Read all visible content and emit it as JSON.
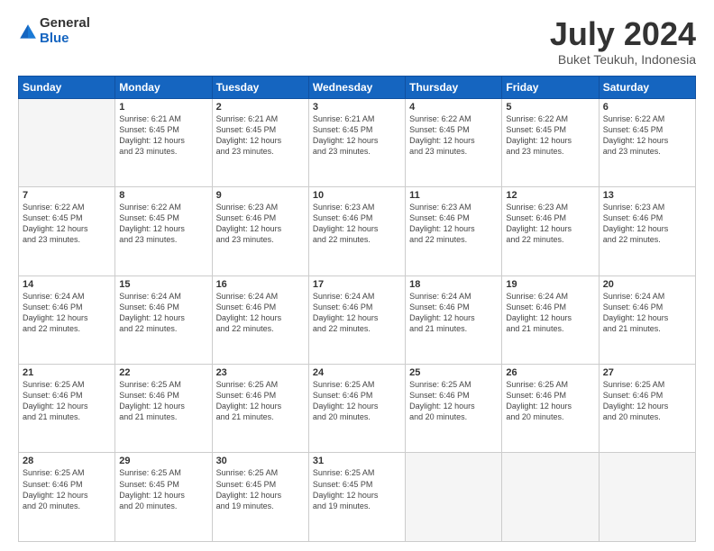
{
  "logo": {
    "general": "General",
    "blue": "Blue"
  },
  "header": {
    "month": "July 2024",
    "location": "Buket Teukuh, Indonesia"
  },
  "weekdays": [
    "Sunday",
    "Monday",
    "Tuesday",
    "Wednesday",
    "Thursday",
    "Friday",
    "Saturday"
  ],
  "weeks": [
    [
      {
        "day": "",
        "info": ""
      },
      {
        "day": "1",
        "info": "Sunrise: 6:21 AM\nSunset: 6:45 PM\nDaylight: 12 hours\nand 23 minutes."
      },
      {
        "day": "2",
        "info": "Sunrise: 6:21 AM\nSunset: 6:45 PM\nDaylight: 12 hours\nand 23 minutes."
      },
      {
        "day": "3",
        "info": "Sunrise: 6:21 AM\nSunset: 6:45 PM\nDaylight: 12 hours\nand 23 minutes."
      },
      {
        "day": "4",
        "info": "Sunrise: 6:22 AM\nSunset: 6:45 PM\nDaylight: 12 hours\nand 23 minutes."
      },
      {
        "day": "5",
        "info": "Sunrise: 6:22 AM\nSunset: 6:45 PM\nDaylight: 12 hours\nand 23 minutes."
      },
      {
        "day": "6",
        "info": "Sunrise: 6:22 AM\nSunset: 6:45 PM\nDaylight: 12 hours\nand 23 minutes."
      }
    ],
    [
      {
        "day": "7",
        "info": "Sunrise: 6:22 AM\nSunset: 6:45 PM\nDaylight: 12 hours\nand 23 minutes."
      },
      {
        "day": "8",
        "info": "Sunrise: 6:22 AM\nSunset: 6:45 PM\nDaylight: 12 hours\nand 23 minutes."
      },
      {
        "day": "9",
        "info": "Sunrise: 6:23 AM\nSunset: 6:46 PM\nDaylight: 12 hours\nand 23 minutes."
      },
      {
        "day": "10",
        "info": "Sunrise: 6:23 AM\nSunset: 6:46 PM\nDaylight: 12 hours\nand 22 minutes."
      },
      {
        "day": "11",
        "info": "Sunrise: 6:23 AM\nSunset: 6:46 PM\nDaylight: 12 hours\nand 22 minutes."
      },
      {
        "day": "12",
        "info": "Sunrise: 6:23 AM\nSunset: 6:46 PM\nDaylight: 12 hours\nand 22 minutes."
      },
      {
        "day": "13",
        "info": "Sunrise: 6:23 AM\nSunset: 6:46 PM\nDaylight: 12 hours\nand 22 minutes."
      }
    ],
    [
      {
        "day": "14",
        "info": "Sunrise: 6:24 AM\nSunset: 6:46 PM\nDaylight: 12 hours\nand 22 minutes."
      },
      {
        "day": "15",
        "info": "Sunrise: 6:24 AM\nSunset: 6:46 PM\nDaylight: 12 hours\nand 22 minutes."
      },
      {
        "day": "16",
        "info": "Sunrise: 6:24 AM\nSunset: 6:46 PM\nDaylight: 12 hours\nand 22 minutes."
      },
      {
        "day": "17",
        "info": "Sunrise: 6:24 AM\nSunset: 6:46 PM\nDaylight: 12 hours\nand 22 minutes."
      },
      {
        "day": "18",
        "info": "Sunrise: 6:24 AM\nSunset: 6:46 PM\nDaylight: 12 hours\nand 21 minutes."
      },
      {
        "day": "19",
        "info": "Sunrise: 6:24 AM\nSunset: 6:46 PM\nDaylight: 12 hours\nand 21 minutes."
      },
      {
        "day": "20",
        "info": "Sunrise: 6:24 AM\nSunset: 6:46 PM\nDaylight: 12 hours\nand 21 minutes."
      }
    ],
    [
      {
        "day": "21",
        "info": "Sunrise: 6:25 AM\nSunset: 6:46 PM\nDaylight: 12 hours\nand 21 minutes."
      },
      {
        "day": "22",
        "info": "Sunrise: 6:25 AM\nSunset: 6:46 PM\nDaylight: 12 hours\nand 21 minutes."
      },
      {
        "day": "23",
        "info": "Sunrise: 6:25 AM\nSunset: 6:46 PM\nDaylight: 12 hours\nand 21 minutes."
      },
      {
        "day": "24",
        "info": "Sunrise: 6:25 AM\nSunset: 6:46 PM\nDaylight: 12 hours\nand 20 minutes."
      },
      {
        "day": "25",
        "info": "Sunrise: 6:25 AM\nSunset: 6:46 PM\nDaylight: 12 hours\nand 20 minutes."
      },
      {
        "day": "26",
        "info": "Sunrise: 6:25 AM\nSunset: 6:46 PM\nDaylight: 12 hours\nand 20 minutes."
      },
      {
        "day": "27",
        "info": "Sunrise: 6:25 AM\nSunset: 6:46 PM\nDaylight: 12 hours\nand 20 minutes."
      }
    ],
    [
      {
        "day": "28",
        "info": "Sunrise: 6:25 AM\nSunset: 6:46 PM\nDaylight: 12 hours\nand 20 minutes."
      },
      {
        "day": "29",
        "info": "Sunrise: 6:25 AM\nSunset: 6:45 PM\nDaylight: 12 hours\nand 20 minutes."
      },
      {
        "day": "30",
        "info": "Sunrise: 6:25 AM\nSunset: 6:45 PM\nDaylight: 12 hours\nand 19 minutes."
      },
      {
        "day": "31",
        "info": "Sunrise: 6:25 AM\nSunset: 6:45 PM\nDaylight: 12 hours\nand 19 minutes."
      },
      {
        "day": "",
        "info": ""
      },
      {
        "day": "",
        "info": ""
      },
      {
        "day": "",
        "info": ""
      }
    ]
  ]
}
